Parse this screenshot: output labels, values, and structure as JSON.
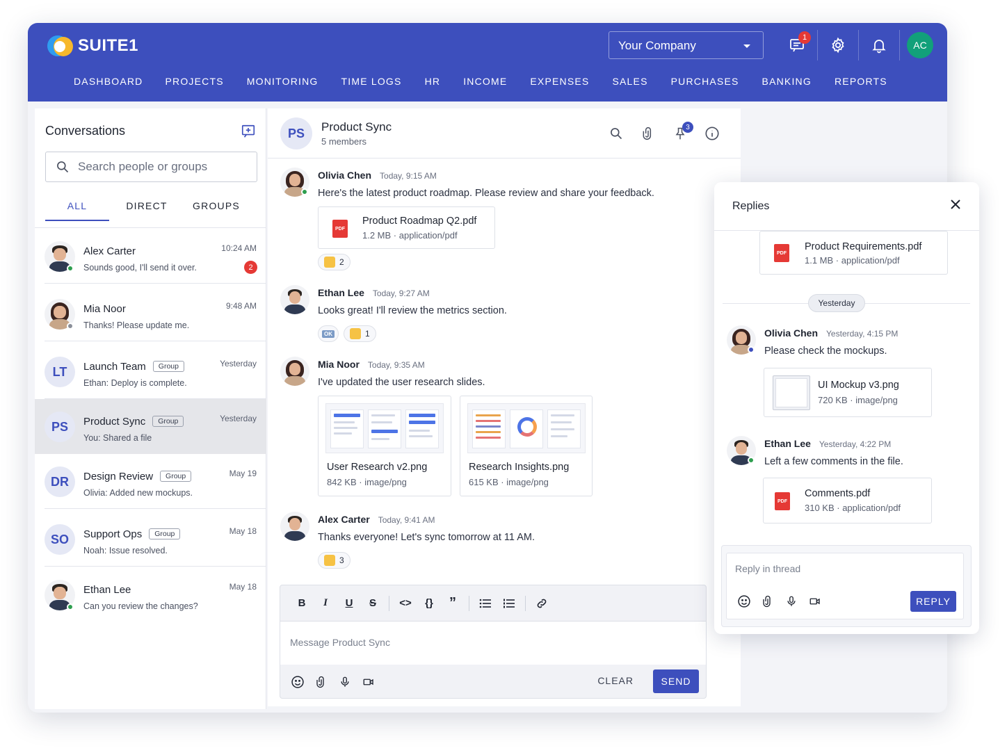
{
  "app": {
    "logo_text": "SUITE1",
    "company_select": "Your Company",
    "notification_badge": "1",
    "user_initials": "AC"
  },
  "nav": [
    "DASHBOARD",
    "PROJECTS",
    "MONITORING",
    "TIME LOGS",
    "HR",
    "INCOME",
    "EXPENSES",
    "SALES",
    "PURCHASES",
    "BANKING",
    "REPORTS"
  ],
  "sidebar": {
    "title": "Conversations",
    "search_placeholder": "Search people or groups",
    "tabs": [
      "ALL",
      "DIRECT",
      "GROUPS"
    ],
    "conversations": [
      {
        "name": "Alex Carter",
        "preview": "Sounds good, I'll send it over.",
        "time": "10:24 AM",
        "unread": "2"
      },
      {
        "name": "Mia Noor",
        "preview": "Thanks! Please update me.",
        "time": "9:48 AM"
      },
      {
        "initials": "LT",
        "name": "Launch Team",
        "tag": "Group",
        "preview": "Ethan: Deploy is complete.",
        "time": "Yesterday"
      },
      {
        "initials": "PS",
        "name": "Product Sync",
        "tag": "Group",
        "preview": "You: Shared a file",
        "time": "Yesterday"
      },
      {
        "initials": "DR",
        "name": "Design Review",
        "tag": "Group",
        "preview": "Olivia: Added new mockups.",
        "time": "May 19"
      },
      {
        "initials": "SO",
        "name": "Support Ops",
        "tag": "Group",
        "preview": "Noah: Issue resolved.",
        "time": "May 18"
      },
      {
        "name": "Ethan Lee",
        "preview": "Can you review the changes?",
        "time": "May 18"
      }
    ]
  },
  "chat": {
    "initials": "PS",
    "title": "Product Sync",
    "members": "5 members",
    "pin_badge": "3",
    "messages": [
      {
        "author": "Olivia Chen",
        "time": "Today, 9:15 AM",
        "text": "Here's the latest product roadmap. Please review and share your feedback.",
        "file": {
          "name": "Product Roadmap Q2.pdf",
          "meta": "1.2 MB · application/pdf"
        },
        "reaction_count": "2"
      },
      {
        "author": "Ethan Lee",
        "time": "Today, 9:27 AM",
        "text": "Looks great! I'll review the metrics section.",
        "ok_label": "OK",
        "reaction_count": "1"
      },
      {
        "author": "Mia Noor",
        "time": "Today, 9:35 AM",
        "text": "I've updated the user research slides.",
        "images": [
          {
            "name": "User Research v2.png",
            "meta": "842 KB · image/png"
          },
          {
            "name": "Research Insights.png",
            "meta": "615 KB · image/png"
          }
        ]
      },
      {
        "author": "Alex Carter",
        "time": "Today, 9:41 AM",
        "text": "Thanks everyone! Let's sync tomorrow at 11 AM.",
        "reaction_count": "3"
      }
    ],
    "composer": {
      "placeholder": "Message Product Sync",
      "clear_label": "CLEAR",
      "send_label": "SEND"
    }
  },
  "replies": {
    "title": "Replies",
    "top_file": {
      "name": "Product Requirements.pdf",
      "meta": "1.1 MB · application/pdf"
    },
    "day_label": "Yesterday",
    "items": [
      {
        "author": "Olivia Chen",
        "time": "Yesterday, 4:15 PM",
        "text": "Please check the mockups.",
        "file": {
          "name": "UI Mockup v3.png",
          "meta": "720 KB · image/png"
        }
      },
      {
        "author": "Ethan Lee",
        "time": "Yesterday, 4:22 PM",
        "text": "Left a few comments in the file.",
        "file": {
          "name": "Comments.pdf",
          "meta": "310 KB · application/pdf"
        }
      }
    ],
    "reply_placeholder": "Reply in thread",
    "reply_label": "REPLY"
  },
  "colors": {
    "primary": "#3d4fbd",
    "online": "#2e9e4f",
    "badge": "#e53935",
    "avatar_bg": "#12a07a"
  }
}
